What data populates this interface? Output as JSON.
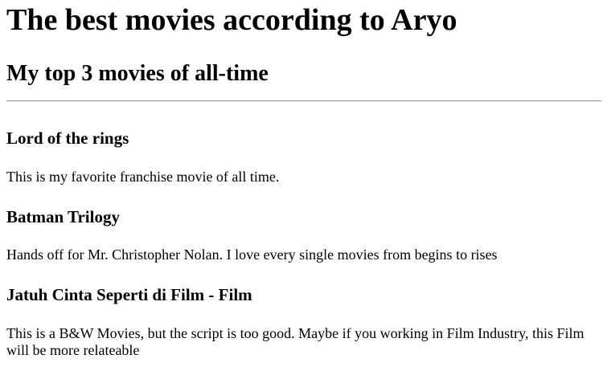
{
  "page": {
    "title": "The best movies according to Aryo",
    "subtitle": "My top 3 movies of all-time"
  },
  "movies": [
    {
      "name": "Lord of the rings",
      "description": "This is my favorite franchise movie of all time."
    },
    {
      "name": "Batman Trilogy",
      "description": "Hands off for Mr. Christopher Nolan. I love every single movies from begins to rises"
    },
    {
      "name": "Jatuh Cinta Seperti di Film - Film",
      "description": "This is a B&W Movies, but the script is too good. Maybe if you working in Film Industry, this Film will be more relateable"
    }
  ]
}
